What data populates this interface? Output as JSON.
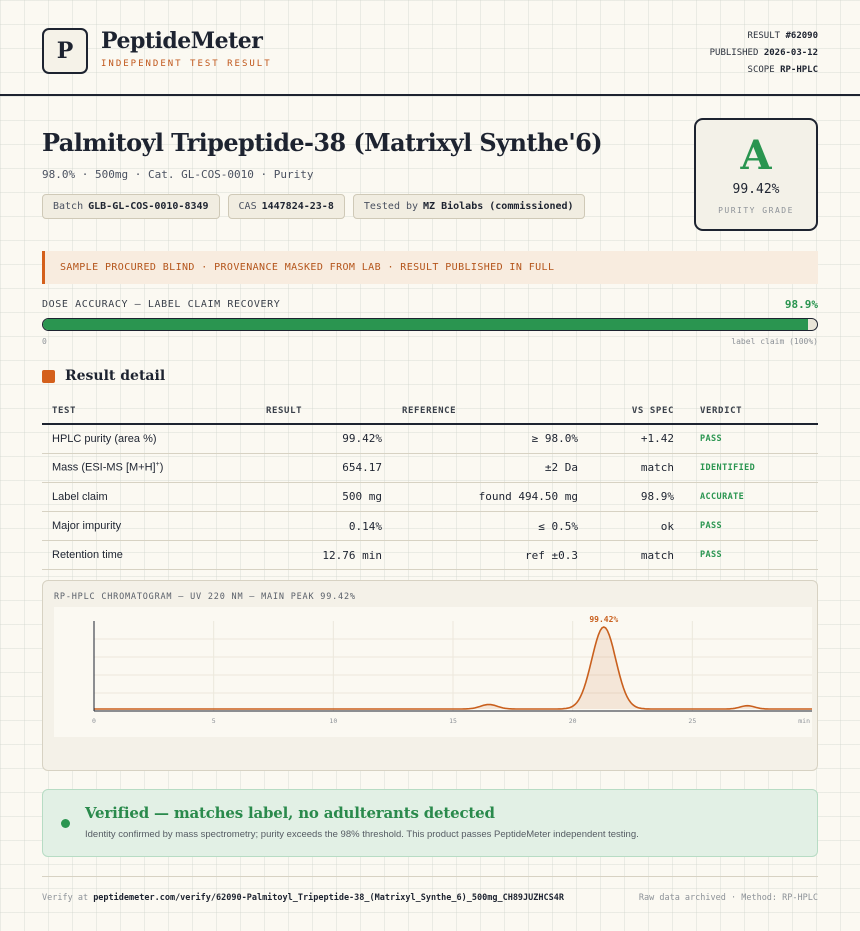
{
  "brand": {
    "logo_letter": "P",
    "name": "PeptideMeter",
    "tagline": "INDEPENDENT TEST RESULT"
  },
  "meta": {
    "result_label": "RESULT",
    "result_value": "#62090",
    "published_label": "PUBLISHED",
    "published_value": "2026-03-12",
    "scope_label": "SCOPE",
    "scope_value": "RP-HPLC"
  },
  "product": {
    "title": "Palmitoyl Tripeptide-38 (Matrixyl Synthe'6)",
    "subtitle": "98.0% · 500mg · Cat. GL-COS-0010 · Purity",
    "chips": [
      {
        "label": "Batch",
        "value": "GLB-GL-COS-0010-8349"
      },
      {
        "label": "CAS",
        "value": "1447824-23-8"
      },
      {
        "label": "Tested by",
        "value": "MZ Biolabs (commissioned)"
      }
    ]
  },
  "grade": {
    "letter": "A",
    "value": "99.42%",
    "label": "PURITY GRADE"
  },
  "banner": {
    "text": "SAMPLE PROCURED BLIND · PROVENANCE MASKED FROM LAB · RESULT PUBLISHED IN FULL"
  },
  "dose": {
    "label": "DOSE ACCURACY — LABEL CLAIM RECOVERY",
    "value": "98.9%",
    "fraction": 0.989,
    "min_label": "0",
    "max_label": "label claim (100%)"
  },
  "result_detail": {
    "title": "Result detail",
    "headers": [
      "TEST",
      "RESULT",
      "REFERENCE",
      "VS SPEC",
      "VERDICT"
    ],
    "rows": [
      {
        "test": "HPLC purity (area %)",
        "result": "99.42%",
        "reference": "≥ 98.0%",
        "vs": "+1.42",
        "verdict": "PASS"
      },
      {
        "test": "Mass (ESI-MS [M+H]",
        "test_sup": "+",
        "test_end": ")",
        "result": "654.17",
        "reference": "±2 Da",
        "vs": "match",
        "verdict": "IDENTIFIED"
      },
      {
        "test": "Label claim",
        "result": "500 mg",
        "reference": "found 494.50 mg",
        "vs": "98.9%",
        "verdict": "ACCURATE"
      },
      {
        "test": "Major impurity",
        "result": "0.14%",
        "reference": "≤ 0.5%",
        "vs": "ok",
        "verdict": "PASS"
      },
      {
        "test": "Retention time",
        "result": "12.76 min",
        "reference": "ref ±0.3",
        "vs": "match",
        "verdict": "PASS"
      }
    ]
  },
  "chart_data": {
    "type": "line",
    "title": "RP-HPLC CHROMATOGRAM — UV 220 NM — MAIN PEAK 99.42%",
    "xlabel": "",
    "ylabel": "",
    "xlim": [
      0,
      30
    ],
    "x_ticks": [
      "0",
      "5",
      "10",
      "15",
      "20",
      "25"
    ],
    "x_end_label": "min",
    "peaks": [
      {
        "x": 16.5,
        "height": 0.055,
        "width": 0.35
      },
      {
        "x": 21.3,
        "height": 1.0,
        "width": 0.5,
        "label": "99.42%"
      },
      {
        "x": 27.3,
        "height": 0.04,
        "width": 0.3
      }
    ],
    "color": "#c9601e"
  },
  "verified": {
    "headline": "Verified — matches label, no adulterants detected",
    "detail": "Identity confirmed by mass spectrometry; purity exceeds the 98% threshold. This product passes PeptideMeter independent testing."
  },
  "footer": {
    "verify_prefix": "Verify at",
    "verify_url": "peptidemeter.com/verify/62090-Palmitoyl_Tripeptide-38_(Matrixyl_Synthe_6)_500mg_CH89JUZHCS4R",
    "right_text": "Raw data archived · Method: RP-HPLC"
  },
  "colors": {
    "accent": "#d4601c",
    "pass": "#2a9550",
    "ink": "#1d2330"
  }
}
